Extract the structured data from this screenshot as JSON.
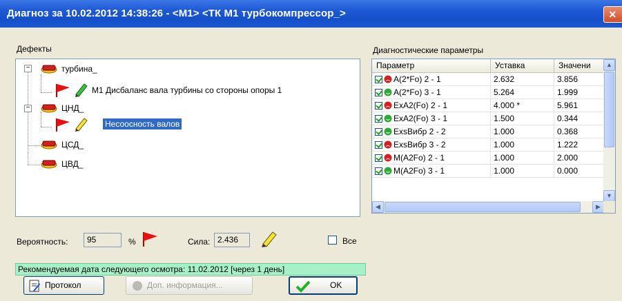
{
  "window": {
    "title": "Диагноз за 10.02.2012 14:38:26 - <M1> <ТК М1 турбокомпрессор_>",
    "close_glyph": "×"
  },
  "defects": {
    "label": "Дефекты",
    "nodes": [
      {
        "label": "турбина_",
        "expanded": true,
        "icon": "red-component-icon"
      },
      {
        "label": "М1 Дисбаланс вала турбины со стороны опоры 1",
        "icon": "red-flag-icon",
        "pencil": "green-pencil-icon"
      },
      {
        "label": "ЦНД_",
        "expanded": true,
        "icon": "red-component-icon"
      },
      {
        "label": "Несоосность валов",
        "icon": "red-flag-icon",
        "pencil": "yellow-pencil-icon",
        "selected": true
      },
      {
        "label": "ЦСД_",
        "icon": "red-component-icon"
      },
      {
        "label": "ЦВД_",
        "icon": "red-component-icon"
      }
    ],
    "expander_minus": "−"
  },
  "params": {
    "label": "Диагностические параметры",
    "columns": [
      "Параметр",
      "Уставка",
      "Значени"
    ],
    "rows": [
      {
        "name": "A(2*Fo) 2 - 1",
        "setpoint": "2.632",
        "value": "3.856",
        "status": "red"
      },
      {
        "name": "A(2*Fo) 3 - 1",
        "setpoint": "5.264",
        "value": "1.999",
        "status": "green"
      },
      {
        "name": "ExA2(Fo) 2 - 1",
        "setpoint": "4.000 *",
        "value": "5.961",
        "status": "red"
      },
      {
        "name": "ExA2(Fo) 3 - 1",
        "setpoint": "1.500",
        "value": "0.344",
        "status": "green"
      },
      {
        "name": "ExsВибр 2 - 2",
        "setpoint": "1.000",
        "value": "0.368",
        "status": "green"
      },
      {
        "name": "ExsВибр 3 - 2",
        "setpoint": "1.000",
        "value": "1.222",
        "status": "red"
      },
      {
        "name": "M(A2Fo) 2 - 1",
        "setpoint": "1.000",
        "value": "2.000",
        "status": "red"
      },
      {
        "name": "M(A2Fo) 3 - 1",
        "setpoint": "1.000",
        "value": "0.000",
        "status": "green"
      }
    ],
    "scroll_up": "▲",
    "scroll_down": "▼",
    "scroll_left": "◀",
    "scroll_right": "▶"
  },
  "stats": {
    "probability_label": "Вероятность:",
    "probability_value": "95",
    "percent": "%",
    "strength_label": "Сила:",
    "strength_value": "2.436",
    "all_label": "Все"
  },
  "recommendation": "Рекомендуемая дата следующего осмотра: 11.02.2012 [через 1 день]",
  "buttons": {
    "protocol": "Протокол",
    "more_info": "Доп. информация...",
    "ok": "OK"
  },
  "colors": {
    "titlebar": "#1f5bd6",
    "selection": "#316ac5",
    "recommend_bg": "#a7f0c8",
    "status_red": "#d42020",
    "status_green": "#2fa83a"
  }
}
